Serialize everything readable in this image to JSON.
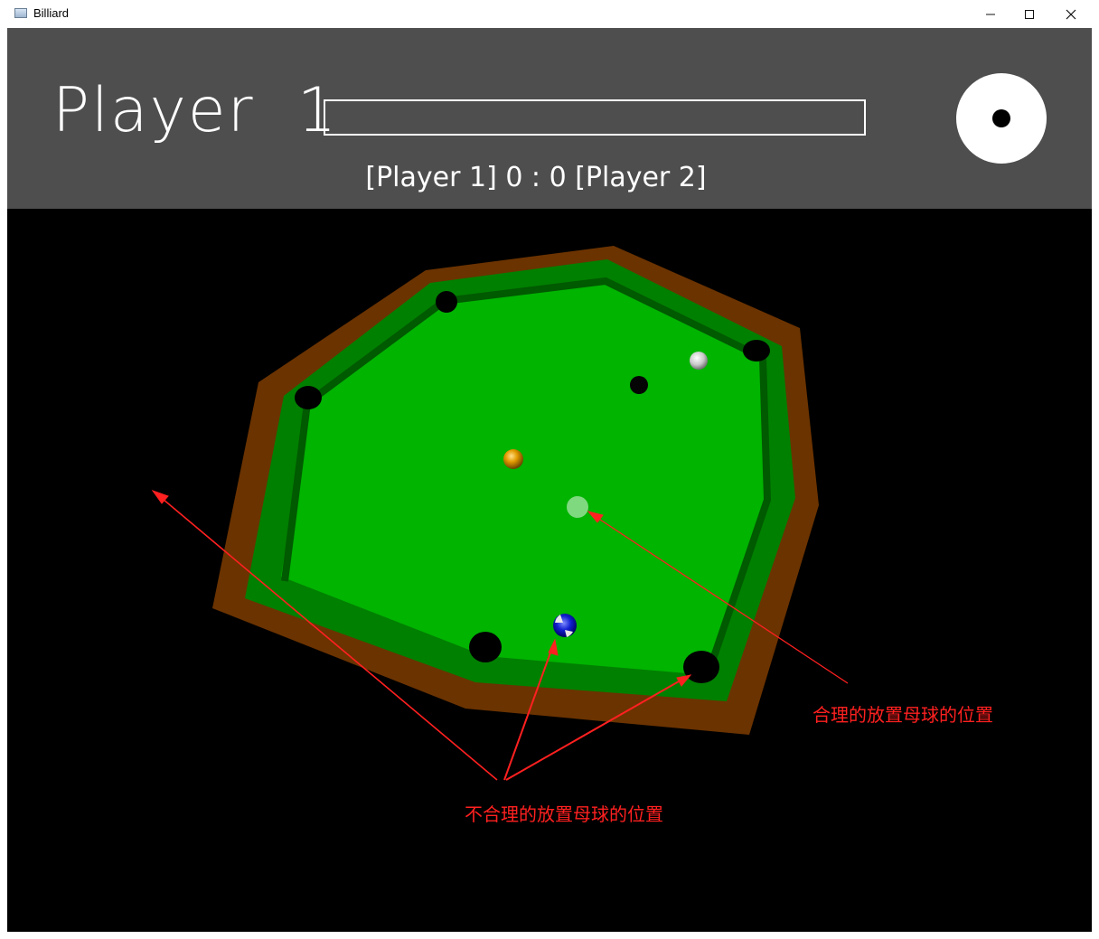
{
  "window": {
    "title": "Billiard"
  },
  "hud": {
    "current_player": "Player  1",
    "power_fraction": 0,
    "scoreline": "[Player 1] 0 : 0 [Player 2]",
    "spin_dial_icon": "cue-ball-spin-icon"
  },
  "annotations": {
    "valid_label": "合理的放置母球的位置",
    "invalid_label": "不合理的放置母球的位置"
  },
  "colors": {
    "felt": "#00b400",
    "cushion": "#008000",
    "rail": "#6b3300",
    "hud_background": "#4e4e4e",
    "annotation": "#ff2020"
  }
}
